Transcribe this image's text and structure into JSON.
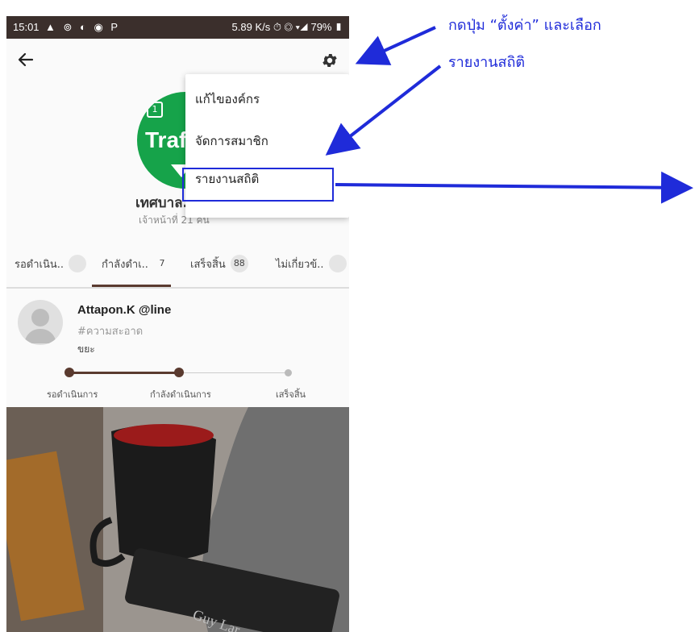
{
  "status_bar": {
    "time": "15:01",
    "left_icons": "▲ ⊚ ◐ ◉ P",
    "right": "5.89 K/s ⏱ ◎ ▾◢ 79% ▮"
  },
  "org": {
    "avatar_text": "Traf",
    "avatar_badge": "1",
    "name": "เทศบาล...",
    "staff_count": "เจ้าหน้าที่ 21 คน"
  },
  "menu": {
    "items": [
      {
        "label": "แก้ไของค์กร"
      },
      {
        "label": "จัดการสมาชิก"
      },
      {
        "label": "รายงานสถิติ"
      }
    ]
  },
  "tabs": [
    {
      "label": "รอดำเนิน..",
      "count": ""
    },
    {
      "label": "กำลังดำเ..",
      "count": "7"
    },
    {
      "label": "เสร็จสิ้น",
      "count": "88"
    },
    {
      "label": "ไม่เกี่ยวข้..",
      "count": ""
    }
  ],
  "post": {
    "user": "Attapon.K @line",
    "tag": "#ความสะอาด",
    "text": "ขยะ",
    "steps": [
      "รอดำเนินการ",
      "กำลังดำเนินการ",
      "เสร็จสิ้น"
    ],
    "photo_label": "Guy Lar"
  },
  "annotation": {
    "line1": "กดปุ่ม “ตั้งค่า” และเลือก",
    "line2": "รายงานสถิติ",
    "color": "#1f2bd9"
  },
  "colors": {
    "accent": "#5a3a2f",
    "brand_green": "#16a34a",
    "status_bar": "#3b2f2c"
  }
}
